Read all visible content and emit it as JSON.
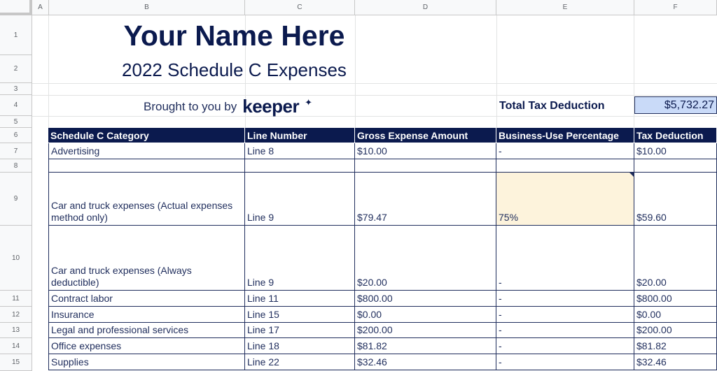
{
  "columns": [
    "A",
    "B",
    "C",
    "D",
    "E",
    "F"
  ],
  "rows": [
    "1",
    "2",
    "3",
    "4",
    "5",
    "6",
    "7",
    "8",
    "9",
    "10",
    "11",
    "12",
    "13",
    "14",
    "15"
  ],
  "header": {
    "name": "Your Name Here",
    "subtitle": "2022 Schedule C Expenses",
    "brought_by": "Brought to you by",
    "brand": "keeper",
    "total_label": "Total Tax Deduction",
    "total_value": "$5,732.27"
  },
  "table": {
    "headers": [
      "Schedule C Category",
      "Line Number",
      "Gross Expense Amount",
      "Business-Use Percentage",
      "Tax Deduction"
    ],
    "rows": [
      [
        "Advertising",
        "Line 8",
        "$10.00",
        "-",
        "$10.00"
      ],
      [
        "",
        "",
        "",
        "",
        ""
      ],
      [
        "Car and truck expenses (Actual expenses method only)",
        "Line 9",
        "$79.47",
        "75%",
        "$59.60"
      ],
      [
        "Car and truck expenses (Always deductible)",
        "Line 9",
        "$20.00",
        "-",
        "$20.00"
      ],
      [
        "Contract labor",
        "Line 11",
        "$800.00",
        "-",
        "$800.00"
      ],
      [
        "Insurance",
        "Line 15",
        "$0.00",
        "-",
        "$0.00"
      ],
      [
        "Legal and professional services",
        "Line 17",
        "$200.00",
        "-",
        "$200.00"
      ],
      [
        "Office expenses",
        "Line 18",
        "$81.82",
        "-",
        "$81.82"
      ],
      [
        "Supplies",
        "Line 22",
        "$32.46",
        "-",
        "$32.46"
      ]
    ]
  },
  "colors": {
    "header_navy": "#0b1a4e",
    "total_fill": "#c9daf8",
    "input_fill": "#fdf3dc"
  },
  "icons": {
    "brand_mark": "sparkle-icon"
  }
}
